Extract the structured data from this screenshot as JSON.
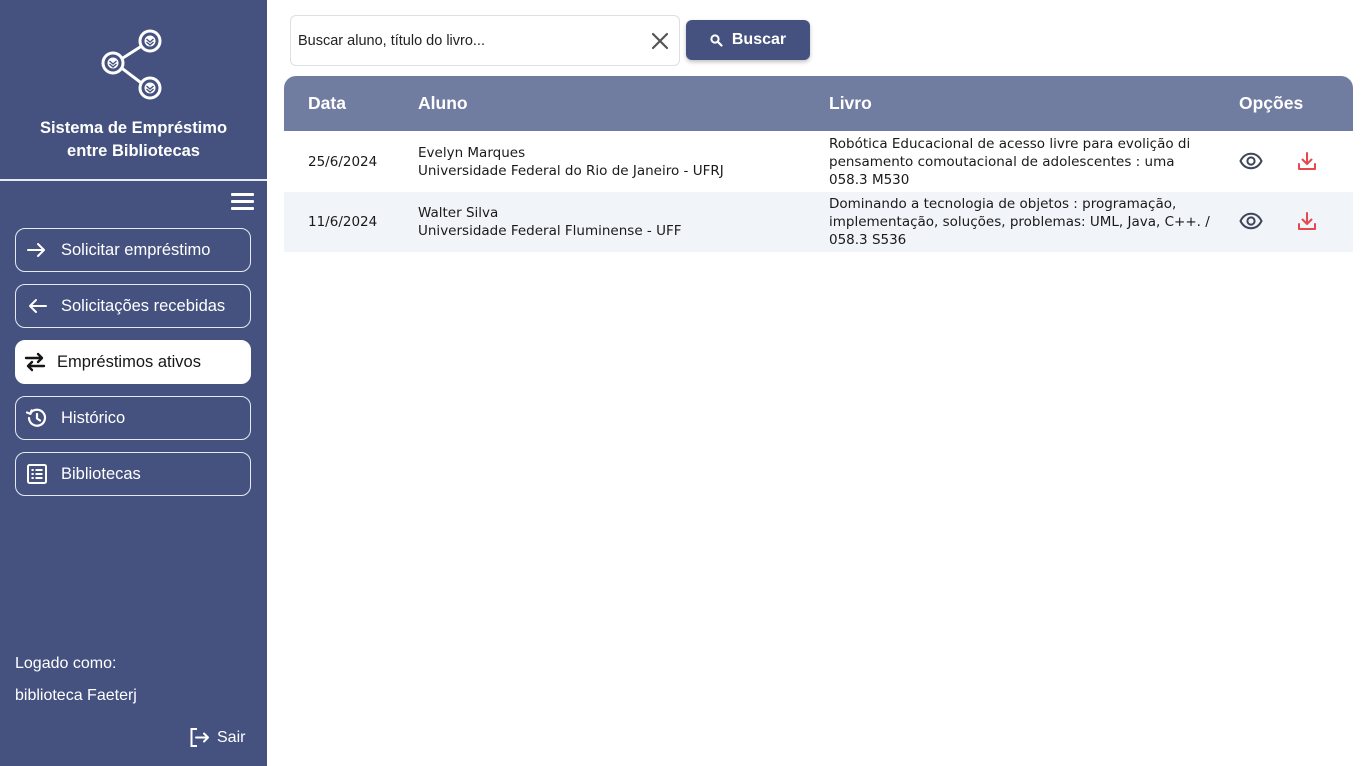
{
  "app": {
    "title": "Sistema de Empréstimo entre Bibliotecas",
    "title_line1": "Sistema de Empréstimo",
    "title_line2": "entre Bibliotecas"
  },
  "colors": {
    "sidebar": "#45527f",
    "table_header": "#717da0",
    "row_alt": "#f1f4f9",
    "download_icon": "#e5484d",
    "view_icon": "#3f4658"
  },
  "sidebar": {
    "menu_icon": "hamburger-menu-icon",
    "items": [
      {
        "label": "Solicitar empréstimo",
        "icon": "arrow-right-icon",
        "active": false
      },
      {
        "label": "Solicitações recebidas",
        "icon": "arrow-left-icon",
        "active": false
      },
      {
        "label": "Empréstimos ativos",
        "icon": "swap-arrows-icon",
        "active": true
      },
      {
        "label": "Histórico",
        "icon": "history-icon",
        "active": false
      },
      {
        "label": "Bibliotecas",
        "icon": "list-icon",
        "active": false
      }
    ],
    "logged_label": "Logado como:",
    "logged_user": "biblioteca Faeterj",
    "logout_label": "Sair"
  },
  "search": {
    "placeholder": "Buscar aluno, título do livro...",
    "value": "",
    "button_label": "Buscar"
  },
  "table": {
    "headers": {
      "date": "Data",
      "student": "Aluno",
      "book": "Livro",
      "options": "Opções"
    },
    "rows": [
      {
        "date": "25/6/2024",
        "student_name": "Evelyn Marques",
        "student_institution": "Universidade Federal do Rio de Janeiro - UFRJ",
        "book_line1": "Robótica Educacional de acesso livre para evolição di",
        "book_line2": "pensamento comoutacional de adolescentes : uma",
        "book_line3": "058.3 M530"
      },
      {
        "date": "11/6/2024",
        "student_name": "Walter Silva",
        "student_institution": "Universidade Federal Fluminense - UFF",
        "book_line1": "Dominando a tecnologia de objetos : programação,",
        "book_line2": "implementação, soluções, problemas: UML, Java, C++. /",
        "book_line3": "058.3 S536"
      }
    ]
  }
}
